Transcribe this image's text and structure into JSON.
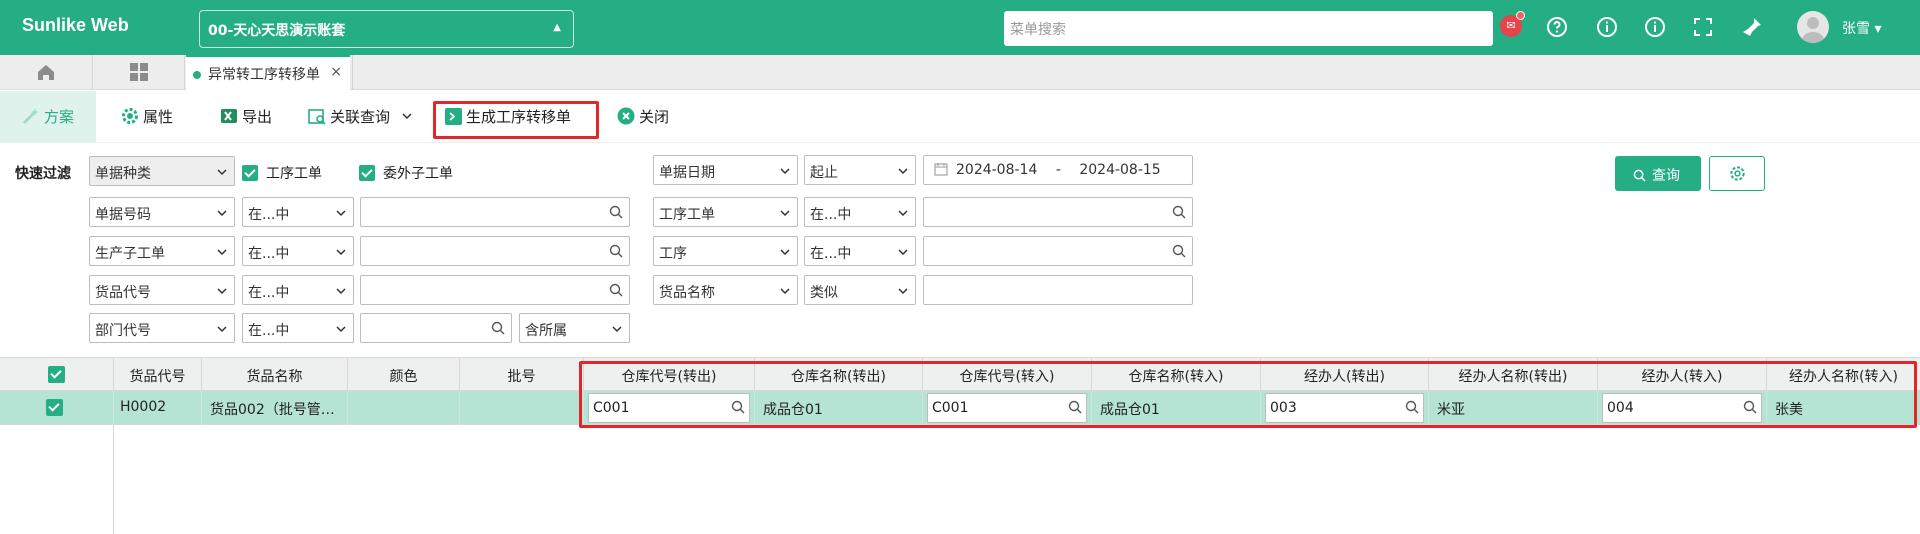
{
  "header": {
    "brand": "Sunlike Web",
    "account": "00-天心天思演示账套",
    "search_placeholder": "菜单搜索",
    "user_name": "张雪",
    "user_caret": "▾"
  },
  "tabs": {
    "active_label": "异常转工序转移单",
    "close": "×"
  },
  "toolbar": {
    "scheme": "方案",
    "properties": "属性",
    "export": "导出",
    "related_query": "关联查询",
    "generate": "生成工序转移单",
    "close": "关闭"
  },
  "filters": {
    "quick_filter_label": "快速过滤",
    "doc_type_select": "单据种类",
    "chk_process_order": "工序工单",
    "chk_outsource_order": "委外子工单",
    "date_field_select": "单据日期",
    "date_range_select": "起止",
    "date_from": "2024-08-14",
    "date_sep": "-",
    "date_to": "2024-08-15",
    "rows_left": [
      {
        "field": "单据号码",
        "op": "在...中"
      },
      {
        "field": "生产子工单",
        "op": "在...中"
      },
      {
        "field": "货品代号",
        "op": "在...中"
      },
      {
        "field": "部门代号",
        "op": "在...中",
        "extra": "含所属"
      }
    ],
    "rows_right": [
      {
        "field": "工序工单",
        "op": "在...中"
      },
      {
        "field": "工序",
        "op": "在...中"
      },
      {
        "field": "货品名称",
        "op": "类似"
      }
    ],
    "query_button": "查询"
  },
  "grid": {
    "columns": [
      "货品代号",
      "货品名称",
      "颜色",
      "批号",
      "仓库代号(转出)",
      "仓库名称(转出)",
      "仓库代号(转入)",
      "仓库名称(转入)",
      "经办人(转出)",
      "经办人名称(转出)",
      "经办人(转入)",
      "经办人名称(转入)"
    ],
    "rows": [
      {
        "item_code": "H0002",
        "item_name": "货品002（批号管…",
        "color": "",
        "batch": "",
        "wh_code_out": "C001",
        "wh_name_out": "成品仓01",
        "wh_code_in": "C001",
        "wh_name_in": "成品仓01",
        "handler_out": "003",
        "handler_name_out": "米亚",
        "handler_in": "004",
        "handler_name_in": "张美"
      }
    ]
  },
  "colors": {
    "brand": "#25ad84",
    "highlight_row": "#b5e4d5",
    "annotation_red": "#e3262a"
  }
}
